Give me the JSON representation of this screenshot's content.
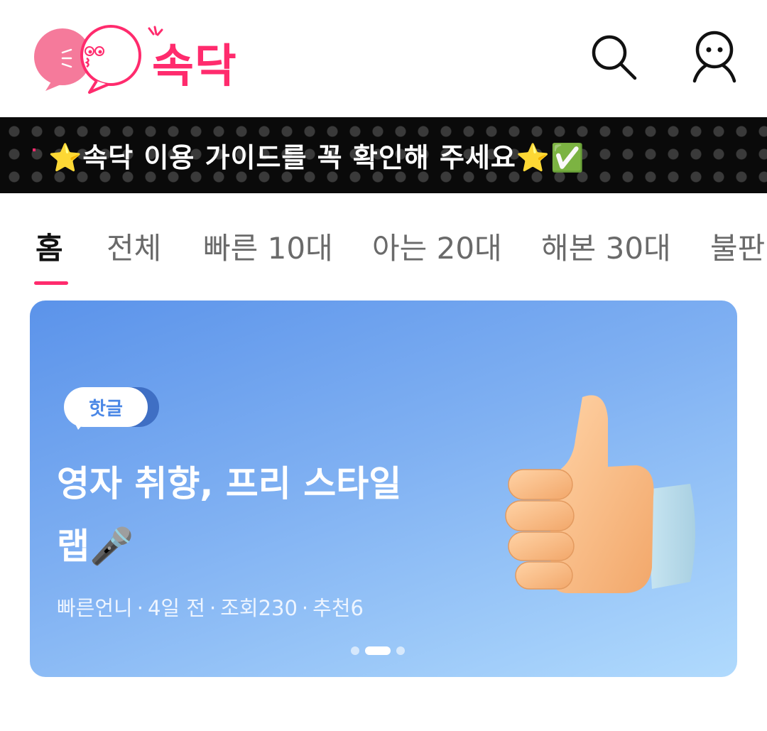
{
  "header": {
    "logo_text": "속닥",
    "search_icon": "search-icon",
    "profile_icon": "profile-icon",
    "brand_color": "#ff2b6d"
  },
  "notice": {
    "text": "⭐속닥 이용 가이드를 꼭 확인해 주세요⭐✅"
  },
  "tabs": [
    {
      "label": "홈",
      "active": true
    },
    {
      "label": "전체"
    },
    {
      "label": "빠른 10대"
    },
    {
      "label": "아는 20대"
    },
    {
      "label": "해본 30대"
    },
    {
      "label": "불판"
    }
  ],
  "hero": {
    "badge": "핫글",
    "title_line1": "영자 취향, 프리 스타일",
    "title_line2": "랩🎤",
    "meta": {
      "author": "빠른언니",
      "time": "4일 전",
      "views": "조회230",
      "likes": "추천6"
    },
    "carousel": {
      "count": 3,
      "active_index": 1
    },
    "image_icon": "thumbs-up-icon"
  }
}
